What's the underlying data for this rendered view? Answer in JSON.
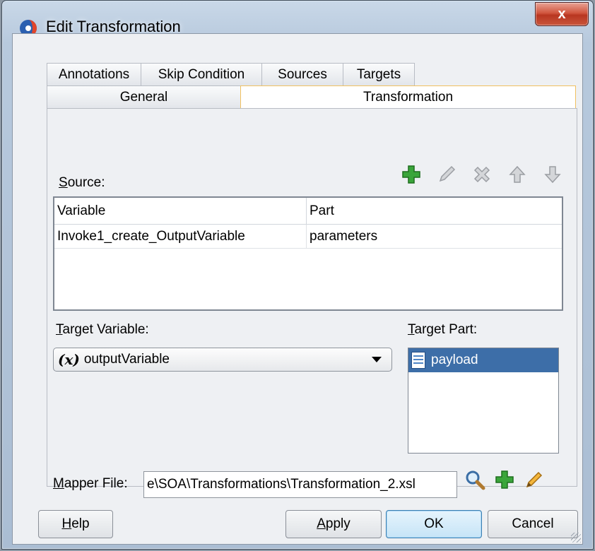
{
  "window": {
    "title": "Edit Transformation",
    "close_label": "x"
  },
  "tabs_row1": [
    "Annotations",
    "Skip Condition",
    "Sources",
    "Targets"
  ],
  "tabs_row2": {
    "general": "General",
    "transformation": "Transformation"
  },
  "source": {
    "label_first": "S",
    "label_rest": "ource:",
    "columns": [
      "Variable",
      "Part"
    ],
    "rows": [
      {
        "variable": "Invoke1_create_OutputVariable",
        "part": "parameters"
      }
    ]
  },
  "target_variable": {
    "label_first": "T",
    "label_rest": "arget Variable:",
    "icon_text": "(x)",
    "value": "outputVariable"
  },
  "target_part": {
    "label_first": "T",
    "label_rest": "arget Part:",
    "items": [
      "payload"
    ]
  },
  "mapper": {
    "label_first": "M",
    "label_rest": "apper File:",
    "value": "e\\SOA\\Transformations\\Transformation_2.xsl"
  },
  "buttons": {
    "help_first": "H",
    "help_rest": "elp",
    "apply_first": "A",
    "apply_rest": "pply",
    "ok": "OK",
    "cancel": "Cancel"
  },
  "icons": {
    "toolbar": [
      "add-icon",
      "edit-icon",
      "delete-icon",
      "move-up-icon",
      "move-down-icon"
    ],
    "mapper": [
      "search-icon",
      "add-icon",
      "edit-icon"
    ]
  },
  "colors": {
    "selection": "#3d6ea8",
    "active_tab_border": "#f0c060",
    "add_green": "#3aa53a"
  }
}
